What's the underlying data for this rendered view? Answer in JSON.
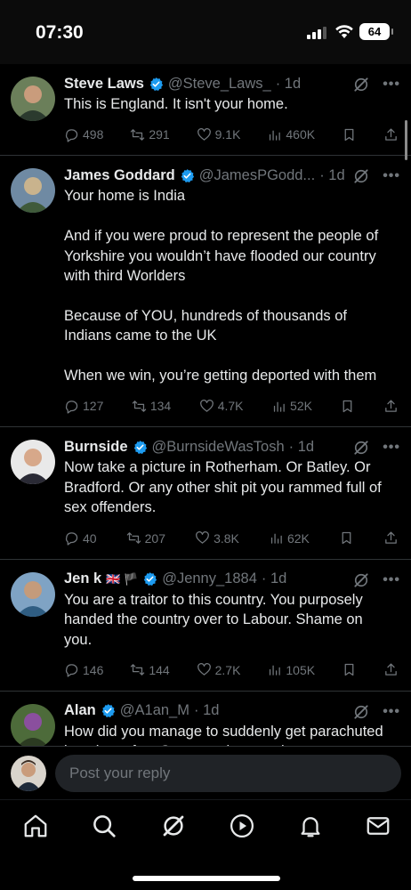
{
  "status_bar": {
    "time": "07:30",
    "battery": "64"
  },
  "tweets": [
    {
      "name": "Steve Laws",
      "verified": true,
      "handle": "@Steve_Laws_",
      "time": "· 1d",
      "flags": "",
      "text": "This is England. It isn't your home.",
      "replies": "498",
      "reposts": "291",
      "likes": "9.1K",
      "views": "460K",
      "avatar_colors": [
        "#6b7f5a",
        "#c99c7c",
        "#2b3a2e"
      ]
    },
    {
      "name": "James Goddard",
      "verified": true,
      "handle": "@JamesPGodd...",
      "time": "· 1d",
      "flags": "",
      "text": "Your home is India\n\nAnd if you were proud to represent the people of Yorkshire you wouldn’t have flooded our country with third Worlders\n\nBecause of YOU, hundreds of thousands of Indians came to the UK\n\nWhen we win, you’re getting deported with them",
      "replies": "127",
      "reposts": "134",
      "likes": "4.7K",
      "views": "52K",
      "avatar_colors": [
        "#6f8aa3",
        "#c9b38d",
        "#3f5a3a"
      ]
    },
    {
      "name": "Burnside",
      "verified": true,
      "handle": "@BurnsideWasTosh",
      "time": "· 1d",
      "flags": "",
      "text": "Now take a picture in Rotherham. Or Batley. Or Bradford. Or any other shit pit you rammed full of sex offenders.",
      "replies": "40",
      "reposts": "207",
      "likes": "3.8K",
      "views": "62K",
      "avatar_colors": [
        "#e9e9e9",
        "#d7a88a",
        "#2a2a35"
      ]
    },
    {
      "name": "Jen k",
      "verified": true,
      "handle": "@Jenny_1884",
      "time": "· 1d",
      "flags": "🇬🇧 🏴",
      "text": "You are a traitor to this country. You purposely handed the country over to Labour. Shame on you.",
      "replies": "146",
      "reposts": "144",
      "likes": "2.7K",
      "views": "105K",
      "avatar_colors": [
        "#7fa3c4",
        "#c49b7b",
        "#2f5d82"
      ]
    },
    {
      "name": "Alan",
      "verified": true,
      "handle": "@A1an_M",
      "time": "· 1d",
      "flags": "",
      "text": "How did you manage to suddenly get parachuted into the safest Conservative seat in",
      "replies": "",
      "reposts": "",
      "likes": "",
      "views": "",
      "avatar_colors": [
        "#4d6b3a",
        "#8a4f9e",
        "#2c3b22"
      ]
    }
  ],
  "reply": {
    "placeholder": "Post your reply"
  },
  "tabs": [
    "home-icon",
    "search-icon",
    "grok-icon",
    "video-icon",
    "notifications-icon",
    "messages-icon"
  ],
  "colors": {
    "verified": "#1d9bf0",
    "muted": "#71767b",
    "text": "#e7e9ea",
    "border": "#2f3336"
  }
}
